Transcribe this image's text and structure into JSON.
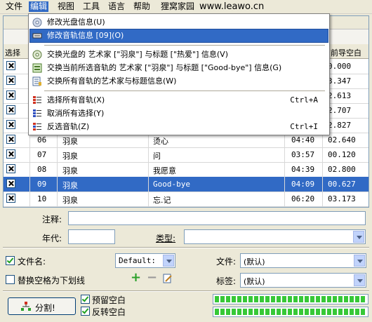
{
  "menubar": {
    "items": [
      "文件",
      "编辑",
      "视图",
      "工具",
      "语言",
      "帮助",
      "狸窝家园"
    ],
    "site": "www.leawo.cn"
  },
  "table": {
    "headers": {
      "select": "选择",
      "blank": "前导空白"
    },
    "rows": [
      {
        "num": "",
        "artist": "",
        "title": "",
        "time": "",
        "gap": "0.000",
        "selected": false
      },
      {
        "num": "",
        "artist": "",
        "title": "",
        "time": "",
        "gap": "3.347",
        "selected": false
      },
      {
        "num": "",
        "artist": "",
        "title": "",
        "time": "",
        "gap": "2.613",
        "selected": false
      },
      {
        "num": "",
        "artist": "",
        "title": "",
        "time": "",
        "gap": "2.707",
        "selected": false
      },
      {
        "num": "",
        "artist": "",
        "title": "",
        "time": "",
        "gap": "2.827",
        "selected": false
      },
      {
        "num": "06",
        "artist": "羽泉",
        "title": "烫心",
        "time": "04:40",
        "gap": "02.640",
        "selected": false
      },
      {
        "num": "07",
        "artist": "羽泉",
        "title": "问",
        "time": "03:57",
        "gap": "00.120",
        "selected": false
      },
      {
        "num": "08",
        "artist": "羽泉",
        "title": "我愿意",
        "time": "04:39",
        "gap": "02.800",
        "selected": false
      },
      {
        "num": "09",
        "artist": "羽泉",
        "title": "Good-bye",
        "time": "04:09",
        "gap": "00.627",
        "selected": true
      },
      {
        "num": "10",
        "artist": "羽泉",
        "title": "忘.记",
        "time": "06:20",
        "gap": "03.173",
        "selected": false
      }
    ]
  },
  "edit_menu": {
    "items": [
      {
        "label": "修改光盘信息(U)",
        "shortcut": "",
        "icon": "disc-icon"
      },
      {
        "label": "修改音轨信息 [09](O)",
        "shortcut": "",
        "icon": "track-icon"
      },
      {
        "label": "交换光盘的 艺术家 [\"羽泉\"] 与标题 [\"热爱\"] 信息(V)",
        "shortcut": "",
        "icon": "swap-disc-icon"
      },
      {
        "label": "交换当前所选音轨的 艺术家 [\"羽泉\"] 与标题 [\"Good-bye\"] 信息(G)",
        "shortcut": "",
        "icon": "swap-track-icon"
      },
      {
        "label": "交换所有音轨的艺术家与标题信息(W)",
        "shortcut": "",
        "icon": "swap-all-icon"
      },
      {
        "label": "选择所有音轨(X)",
        "shortcut": "Ctrl+A",
        "icon": "select-all-icon"
      },
      {
        "label": "取消所有选择(Y)",
        "shortcut": "",
        "icon": "deselect-icon"
      },
      {
        "label": "反选音轨(Z)",
        "shortcut": "Ctrl+I",
        "icon": "invert-icon"
      }
    ]
  },
  "form": {
    "comment_label": "注释:",
    "year_label": "年代:",
    "genre_label": "类型:",
    "filename_label": "文件名:",
    "filename_format": "Default:",
    "replace_space_label": "替换空格为下划线",
    "file_label": "文件:",
    "file_value": "(默认)",
    "tag_label": "标签:",
    "tag_value": "(默认)",
    "split_button": "分割!",
    "keep_blank_label": "预留空白",
    "reverse_blank_label": "反转空白"
  },
  "progress": [
    1.0,
    1.0
  ],
  "colors": {
    "highlight": "#316ac5",
    "window": "#ece9d8",
    "progress": "#37c837"
  }
}
